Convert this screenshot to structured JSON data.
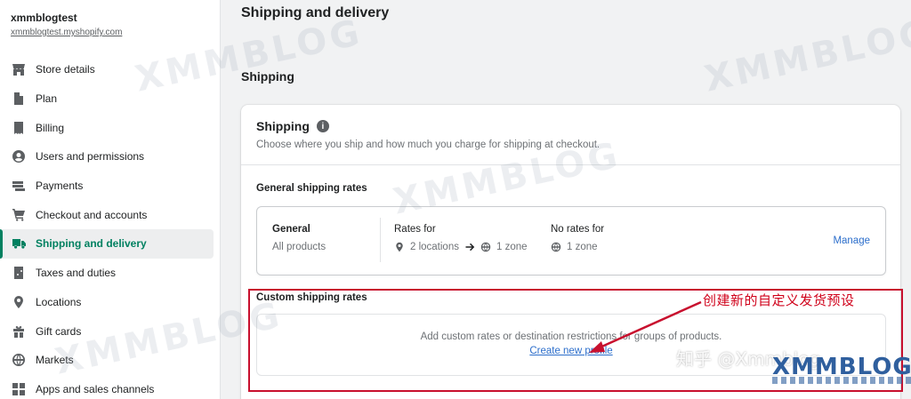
{
  "store": {
    "name": "xmmblogtest",
    "url": "xmmblogtest.myshopify.com"
  },
  "sidebar": {
    "items": [
      {
        "label": "Store details",
        "icon": "store-icon"
      },
      {
        "label": "Plan",
        "icon": "plan-icon"
      },
      {
        "label": "Billing",
        "icon": "billing-icon"
      },
      {
        "label": "Users and permissions",
        "icon": "user-icon"
      },
      {
        "label": "Payments",
        "icon": "payments-icon"
      },
      {
        "label": "Checkout and accounts",
        "icon": "cart-icon"
      },
      {
        "label": "Shipping and delivery",
        "icon": "truck-icon",
        "active": true
      },
      {
        "label": "Taxes and duties",
        "icon": "tax-icon"
      },
      {
        "label": "Locations",
        "icon": "location-icon"
      },
      {
        "label": "Gift cards",
        "icon": "gift-icon"
      },
      {
        "label": "Markets",
        "icon": "globe-icon"
      },
      {
        "label": "Apps and sales channels",
        "icon": "apps-icon"
      }
    ]
  },
  "main": {
    "page_title": "Shipping and delivery",
    "section_heading": "Shipping",
    "card": {
      "title": "Shipping",
      "subtitle": "Choose where you ship and how much you charge for shipping at checkout.",
      "general_title": "General shipping rates",
      "profile": {
        "name": "General",
        "products": "All products",
        "rates_for_label": "Rates for",
        "locations": "2 locations",
        "zone": "1 zone",
        "no_rates_label": "No rates for",
        "no_rates_zone": "1 zone",
        "manage": "Manage"
      },
      "custom_title": "Custom shipping rates",
      "custom_desc": "Add custom rates or destination restrictions for groups of products.",
      "create_link": "Create new profile"
    }
  },
  "annotation": {
    "text": "创建新的自定义发货预设",
    "color": "#d0021b"
  },
  "watermarks": {
    "brand": "XMMBLOG",
    "zhihu": "知乎 @Xmmblog"
  },
  "colors": {
    "accent": "#008060",
    "link": "#2c6ecb"
  }
}
